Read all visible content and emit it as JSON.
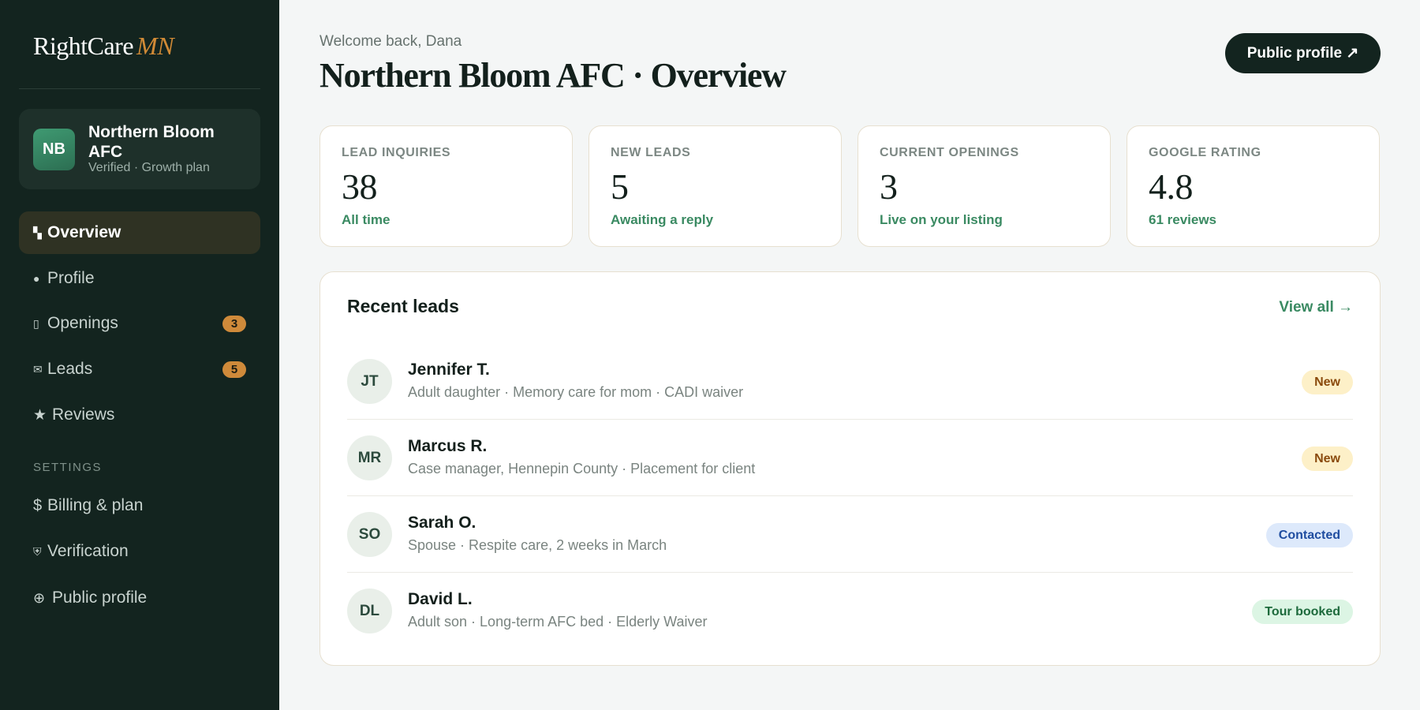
{
  "brand": {
    "name": "RightCare",
    "accent": "MN"
  },
  "facility": {
    "initials": "NB",
    "name": "Northern Bloom AFC",
    "subtitle": "Verified · Growth plan"
  },
  "nav": {
    "items": [
      {
        "icon": "overview-icon",
        "glyph": "▚",
        "label": "Overview",
        "active": true
      },
      {
        "icon": "profile-icon",
        "glyph": "●",
        "label": "Profile"
      },
      {
        "icon": "openings-icon",
        "glyph": "▯",
        "label": "Openings",
        "badge": "3"
      },
      {
        "icon": "leads-icon",
        "glyph": "✉",
        "label": "Leads",
        "badge": "5"
      },
      {
        "icon": "reviews-icon",
        "glyph": "★",
        "label": "Reviews"
      }
    ],
    "settings_heading": "SETTINGS",
    "settings_items": [
      {
        "icon": "billing-icon",
        "glyph": "$",
        "label": "Billing & plan"
      },
      {
        "icon": "verification-icon",
        "glyph": "⛨",
        "label": "Verification"
      },
      {
        "icon": "public-profile-icon",
        "glyph": "⊕",
        "label": "Public profile"
      }
    ]
  },
  "header": {
    "welcome": "Welcome back, Dana",
    "title": "Northern Bloom AFC · Overview",
    "public_button": "Public profile ↗"
  },
  "stats": [
    {
      "label": "LEAD INQUIRIES",
      "value": "38",
      "note": "All time"
    },
    {
      "label": "NEW LEADS",
      "value": "5",
      "note": "Awaiting a reply"
    },
    {
      "label": "CURRENT OPENINGS",
      "value": "3",
      "note": "Live on your listing"
    },
    {
      "label": "GOOGLE RATING",
      "value": "4.8",
      "note": "61 reviews"
    }
  ],
  "recent_leads": {
    "title": "Recent leads",
    "view_all": "View all →",
    "rows": [
      {
        "initials": "JT",
        "name": "Jennifer T.",
        "detail": "Adult daughter · Memory care for mom · CADI waiver",
        "status": "New"
      },
      {
        "initials": "MR",
        "name": "Marcus R.",
        "detail": "Case manager, Hennepin County · Placement for client",
        "status": "New"
      },
      {
        "initials": "SO",
        "name": "Sarah O.",
        "detail": "Spouse · Respite care, 2 weeks in March",
        "status": "Contacted"
      },
      {
        "initials": "DL",
        "name": "David L.",
        "detail": "Adult son · Long-term AFC bed · Elderly Waiver",
        "status": "Tour booked"
      }
    ]
  },
  "colors": {
    "sidebar_bg": "#13241f",
    "accent_orange": "#d08a36",
    "accent_green": "#3a8a62",
    "status_new_bg": "#fdf0c8",
    "status_new_fg": "#8a4a0c",
    "status_contacted_bg": "#dde9fb",
    "status_contacted_fg": "#1f4da0",
    "status_tour_bg": "#dcf5e4",
    "status_tour_fg": "#1d6a3c"
  }
}
